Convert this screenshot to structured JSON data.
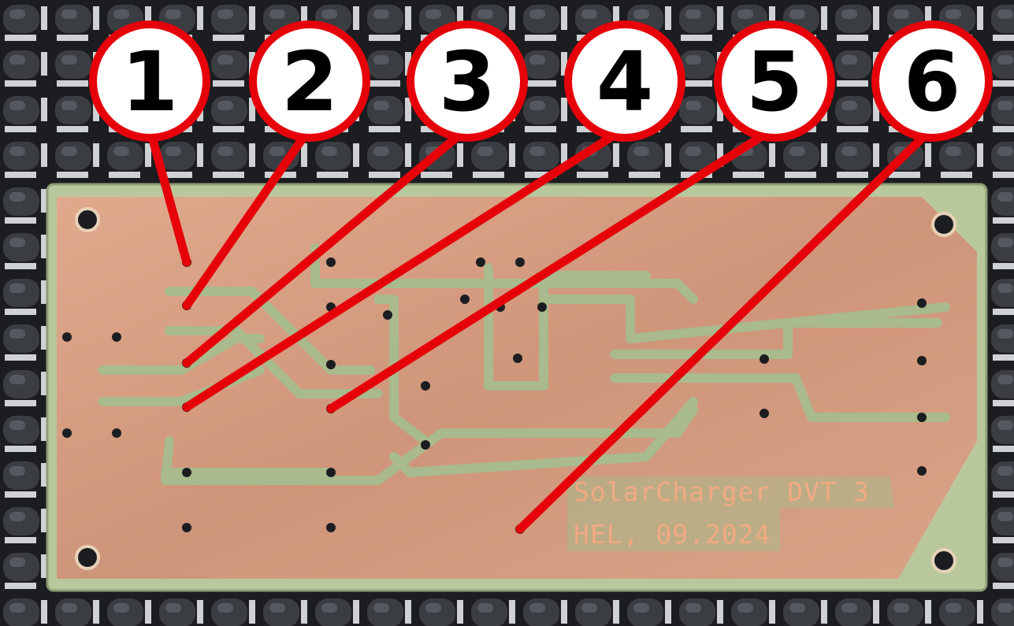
{
  "silkscreen": {
    "line1": "SolarCharger DVT 3",
    "line2": "HEL, 09.2024"
  },
  "callouts": [
    {
      "label": "1"
    },
    {
      "label": "2"
    },
    {
      "label": "3"
    },
    {
      "label": "4"
    },
    {
      "label": "5"
    },
    {
      "label": "6"
    }
  ],
  "colors": {
    "callout_ring": "#e5000a",
    "callout_fill": "#ffffff",
    "board_substrate": "#b7c79a",
    "copper": "#d49c7e",
    "background_mat": "#1a1c1f"
  }
}
